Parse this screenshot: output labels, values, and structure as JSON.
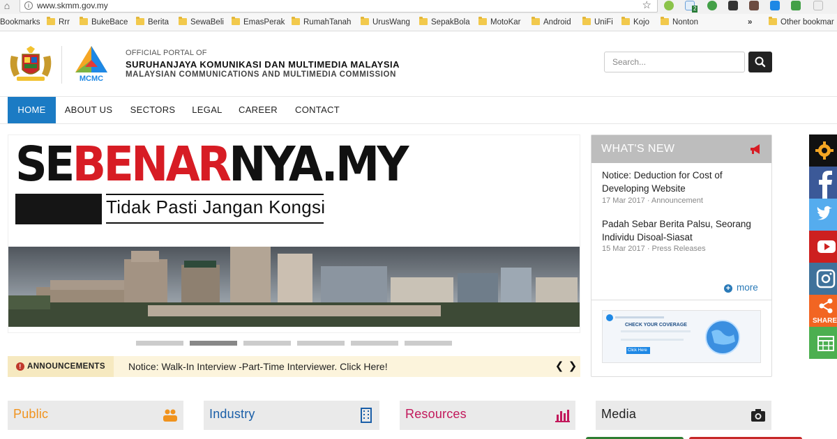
{
  "browser": {
    "url": "www.skmm.gov.my",
    "bookmarks_label": "Bookmarks",
    "bookmarks": [
      "Rrr",
      "BukeBace",
      "Berita",
      "SewaBeli",
      "EmasPerak",
      "RumahTanah",
      "UrusWang",
      "SepakBola",
      "MotoKar",
      "Android",
      "UniFi",
      "Kojo",
      "Nonton"
    ],
    "more_bookmarks": "»",
    "other_bookmarks": "Other bookmar",
    "extension_badge": "2"
  },
  "header": {
    "logo_text": "MCMC",
    "official": "OFFICIAL PORTAL OF",
    "name_ms": "SURUHANJAYA KOMUNIKASI DAN MULTIMEDIA MALAYSIA",
    "name_en": "MALAYSIAN COMMUNICATIONS AND MULTIMEDIA COMMISSION",
    "search_placeholder": "Search..."
  },
  "nav": [
    "HOME",
    "ABOUT US",
    "SECTORS",
    "LEGAL",
    "CAREER",
    "CONTACT"
  ],
  "slider": {
    "title_part1": "SE",
    "title_part2": "BENAR",
    "title_part3": "NYA.MY",
    "tagline": "Tidak Pasti Jangan Kongsi",
    "slide_count": 6,
    "active_slide": 2
  },
  "announcement": {
    "label": "ANNOUNCEMENTS",
    "icon": "!",
    "text": "Notice: Walk-In Interview -Part-Time Interviewer. Click Here!",
    "prev": "❮",
    "next": "❯"
  },
  "whats_new": {
    "heading": "WHAT'S NEW",
    "items": [
      {
        "title": "Notice: Deduction for Cost of Developing Website",
        "meta": "17 Mar 2017 · Announcement"
      },
      {
        "title": "Padah Sebar Berita Palsu, Seorang Individu Disoal-Siasat",
        "meta": "15 Mar 2017 · Press Releases"
      }
    ],
    "more": "more",
    "banner_title": "CHECK YOUR COVERAGE",
    "banner_button": "Click Here"
  },
  "social": {
    "share_label": "SHARE",
    "colors": {
      "settings": "#111111",
      "facebook": "#3b5998",
      "twitter": "#55acee",
      "youtube": "#cd201f",
      "instagram": "#3f729b",
      "share": "#f26522",
      "calendar": "#4caf50"
    }
  },
  "tiles": [
    {
      "label": "Public",
      "color": "#f0931e",
      "icon": "people-icon"
    },
    {
      "label": "Industry",
      "color": "#1b5fa8",
      "icon": "building-icon"
    },
    {
      "label": "Resources",
      "color": "#c2185b",
      "icon": "bar-chart-icon"
    },
    {
      "label": "Media",
      "color": "#222222",
      "icon": "camera-icon"
    }
  ]
}
